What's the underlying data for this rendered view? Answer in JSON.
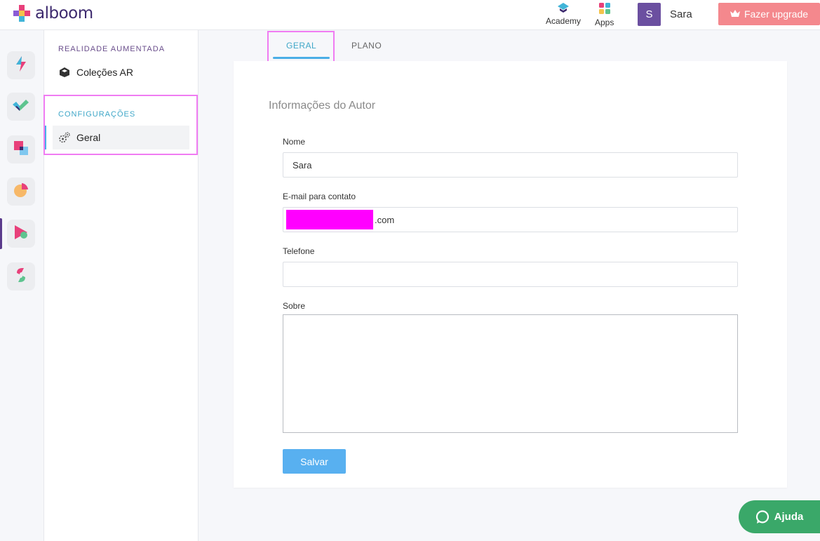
{
  "brand": {
    "name": "alboom"
  },
  "topbar": {
    "academy_label": "Academy",
    "apps_label": "Apps",
    "avatar_initial": "S",
    "username": "Sara",
    "upgrade_label": "Fazer upgrade"
  },
  "rail": {
    "icons": [
      "bolt-icon",
      "check-icon",
      "squares-icon",
      "pie-icon",
      "play-icon",
      "s-logo-icon"
    ],
    "active_index": 4
  },
  "sidebar": {
    "section1_title": "REALIDADE AUMENTADA",
    "item_ar_label": "Coleções AR",
    "section2_title": "CONFIGURAÇÕES",
    "item_geral_label": "Geral"
  },
  "tabs": {
    "geral": "GERAL",
    "plano": "PLANO",
    "active": "GERAL"
  },
  "form": {
    "title": "Informações do Autor",
    "name_label": "Nome",
    "name_value": "Sara",
    "email_label": "E-mail para contato",
    "email_value_suffix": ".com",
    "phone_label": "Telefone",
    "phone_value": "",
    "about_label": "Sobre",
    "about_value": "",
    "save_label": "Salvar"
  },
  "help": {
    "label": "Ajuda"
  },
  "colors": {
    "brand_purple": "#3d2a6e",
    "accent_blue": "#4aaee6",
    "upgrade_pink": "#f4888d",
    "help_green": "#3aa869",
    "annotation_magenta": "#f07cf2"
  }
}
